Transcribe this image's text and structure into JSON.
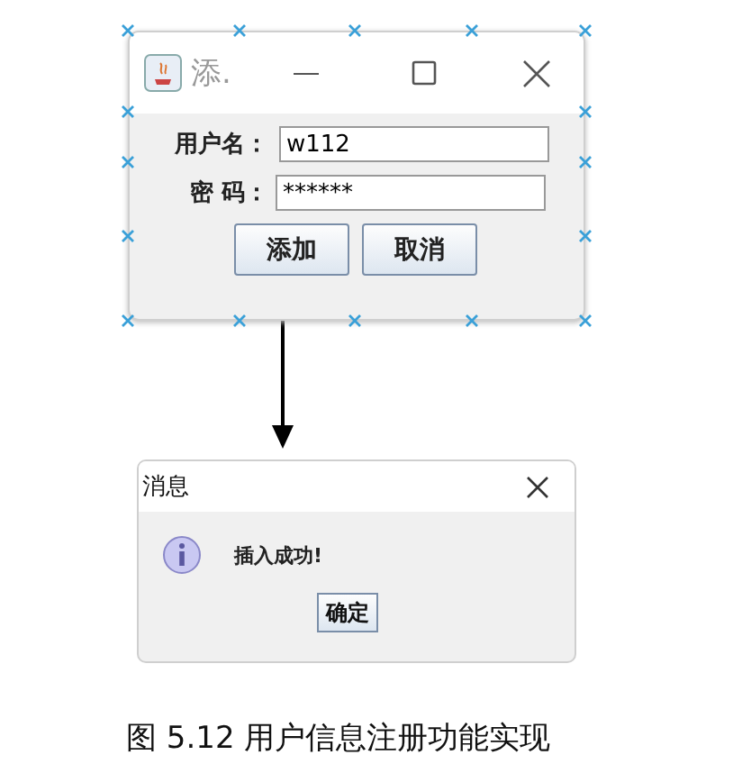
{
  "login_dialog": {
    "title": "添.",
    "fields": [
      {
        "label": "用户名：",
        "value": "w112"
      },
      {
        "label": "密 码：",
        "value": "******"
      }
    ],
    "buttons": [
      "添加",
      "取消"
    ]
  },
  "message_dialog": {
    "title": "消息",
    "message": "插入成功!",
    "button": "确定"
  },
  "caption": "图 5.12 用户信息注册功能实现"
}
